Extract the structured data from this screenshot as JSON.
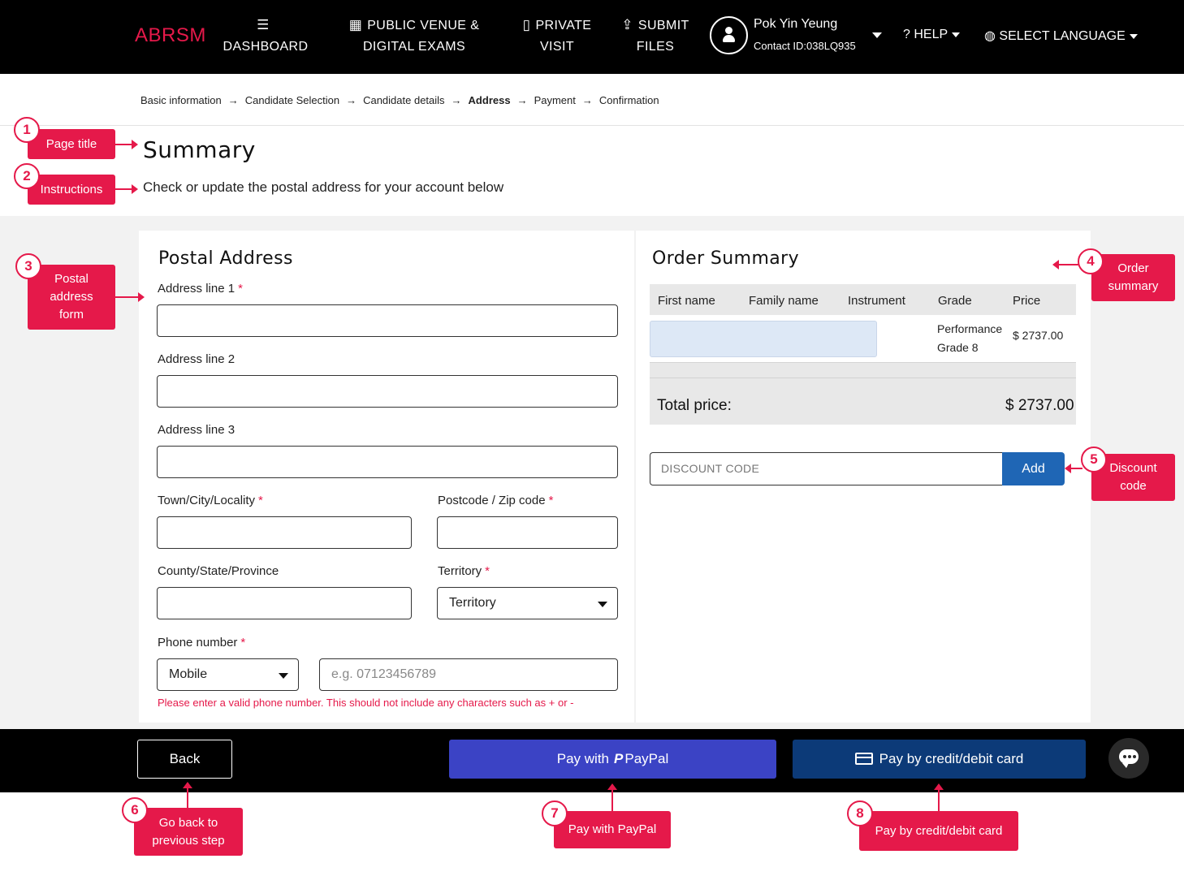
{
  "nav": {
    "brand": "ABRSM",
    "dashboard": "DASHBOARD",
    "public_venue_line1": "PUBLIC VENUE &",
    "public_venue_line2": "DIGITAL EXAMS",
    "private_line1": "PRIVATE",
    "private_line2": "VISIT",
    "submit_line1": "SUBMIT",
    "submit_line2": "FILES",
    "user_name": "Pok Yin Yeung",
    "user_contact": "Contact ID:038LQ935",
    "help": "HELP",
    "language": "SELECT LANGUAGE"
  },
  "breadcrumb": {
    "items": [
      "Basic information",
      "Candidate Selection",
      "Candidate details",
      "Address",
      "Payment",
      "Confirmation"
    ],
    "active": "Address",
    "separator": "→"
  },
  "page": {
    "title": "Summary",
    "instructions": "Check or update the postal address for your account below"
  },
  "postal": {
    "heading": "Postal Address",
    "address1_label": "Address line 1",
    "address2_label": "Address line 2",
    "address3_label": "Address line 3",
    "town_label": "Town/City/Locality",
    "postcode_label": "Postcode / Zip code",
    "county_label": "County/State/Province",
    "territory_label": "Territory",
    "territory_value": "Territory",
    "phone_label": "Phone number",
    "phone_type": "Mobile",
    "phone_placeholder": "e.g. 07123456789",
    "phone_error": "Please enter a valid phone number. This should not include any characters such as + or -",
    "required_mark": "*"
  },
  "order": {
    "heading": "Order Summary",
    "columns": [
      "First name",
      "Family name",
      "Instrument",
      "Grade",
      "Price"
    ],
    "row": {
      "grade_line1": "Performance",
      "grade_line2": "Grade 8",
      "price": "$ 2737.00"
    },
    "total_label": "Total price:",
    "total_value": "$ 2737.00",
    "discount_placeholder": "DISCOUNT CODE",
    "discount_button": "Add"
  },
  "footer": {
    "back": "Back",
    "paypal_prefix": "Pay with",
    "paypal_brand": "PayPal",
    "card": "Pay by credit/debit card"
  },
  "annotations": [
    {
      "num": "1",
      "line1": "Page title"
    },
    {
      "num": "2",
      "line1": "Instructions"
    },
    {
      "num": "3",
      "line1": "Postal",
      "line2": "address",
      "line3": "form"
    },
    {
      "num": "4",
      "line1": "Order",
      "line2": "summary"
    },
    {
      "num": "5",
      "line1": "Discount",
      "line2": "code"
    },
    {
      "num": "6",
      "line1": "Go back to",
      "line2": "previous step"
    },
    {
      "num": "7",
      "line1": "Pay with PayPal"
    },
    {
      "num": "8",
      "line1": "Pay by credit/debit card"
    }
  ],
  "colors": {
    "brand": "#e5194a",
    "paypal": "#3b43c5",
    "card": "#0c3a78",
    "discount_button": "#1f66b5"
  },
  "icons": [
    "list-icon",
    "calendar-icon",
    "id-badge-icon",
    "upload-icon",
    "user-icon",
    "question-icon",
    "globe-icon",
    "paypal-icon",
    "credit-card-icon",
    "chat-icon"
  ]
}
